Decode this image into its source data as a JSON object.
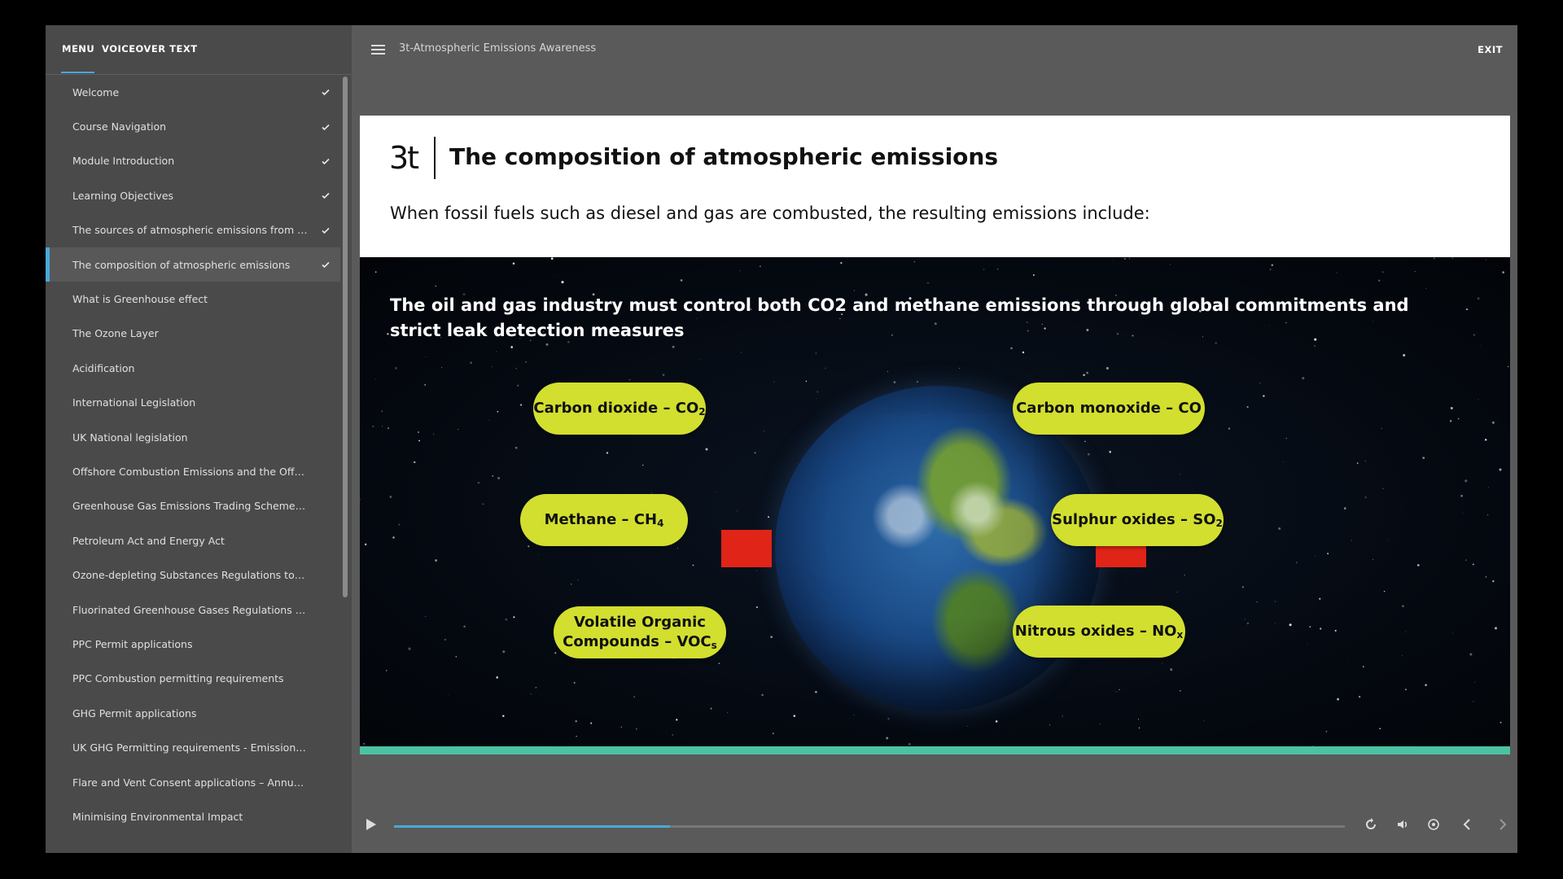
{
  "sidebar": {
    "tabs": {
      "menu": "MENU",
      "voiceover": "VOICEOVER TEXT"
    },
    "items": [
      {
        "label": "Welcome",
        "done": true
      },
      {
        "label": "Course Navigation",
        "done": true
      },
      {
        "label": "Module Introduction",
        "done": true
      },
      {
        "label": "Learning Objectives",
        "done": true
      },
      {
        "label": "The sources of atmospheric emissions from op...",
        "done": true
      },
      {
        "label": "The composition of atmospheric emissions",
        "done": true,
        "active": true
      },
      {
        "label": "What is Greenhouse effect",
        "done": false
      },
      {
        "label": "The Ozone Layer",
        "done": false
      },
      {
        "label": "Acidification",
        "done": false
      },
      {
        "label": "International Legislation",
        "done": false
      },
      {
        "label": "UK National legislation",
        "done": false
      },
      {
        "label": "Offshore Combustion Emissions and the Offsh...",
        "done": false
      },
      {
        "label": "Greenhouse Gas Emissions Trading Scheme R...",
        "done": false
      },
      {
        "label": "Petroleum Act and Energy Act",
        "done": false
      },
      {
        "label": "Ozone-depleting Substances Regulations to pr...",
        "done": false
      },
      {
        "label": "Fluorinated Greenhouse Gases Regulations to ...",
        "done": false
      },
      {
        "label": "PPC Permit applications",
        "done": false
      },
      {
        "label": "PPC Combustion permitting requirements",
        "done": false
      },
      {
        "label": "GHG Permit applications",
        "done": false
      },
      {
        "label": "UK GHG Permitting requirements - Emissions ...",
        "done": false
      },
      {
        "label": "Flare and Vent Consent applications – Annual ...",
        "done": false
      },
      {
        "label": "Minimising Environmental Impact",
        "done": false
      }
    ]
  },
  "topbar": {
    "course_title": "3t-Atmospheric Emissions Awareness",
    "exit_label": "EXIT"
  },
  "slide": {
    "logo": "3t",
    "title": "The composition of atmospheric emissions",
    "subtitle": "When fossil fuels such as diesel and gas are combusted, the resulting emissions include:",
    "intro": "The oil and gas industry must control both CO2 and methane emissions through global commitments and strict leak detection measures",
    "emissions": {
      "co2": {
        "text": "Carbon dioxide – CO",
        "sub": "2"
      },
      "co": {
        "text": "Carbon monoxide – CO"
      },
      "ch4": {
        "text": "Methane – CH",
        "sub": "4"
      },
      "so2": {
        "text": "Sulphur oxides – SO",
        "sub": "2"
      },
      "voc": {
        "line1": "Volatile Organic",
        "line2": "Compounds – VOC",
        "sub": "s"
      },
      "nox": {
        "text": "Nitrous oxides – NO",
        "sub": "x"
      }
    },
    "colors": {
      "pill": "#d2df2f",
      "marker": "#e02418",
      "progress_band": "#4cc2a4"
    }
  },
  "player": {
    "progress": 0.29,
    "icons": [
      "play-icon",
      "replay-icon",
      "volume-icon",
      "captions-icon",
      "previous-icon",
      "next-icon"
    ]
  }
}
